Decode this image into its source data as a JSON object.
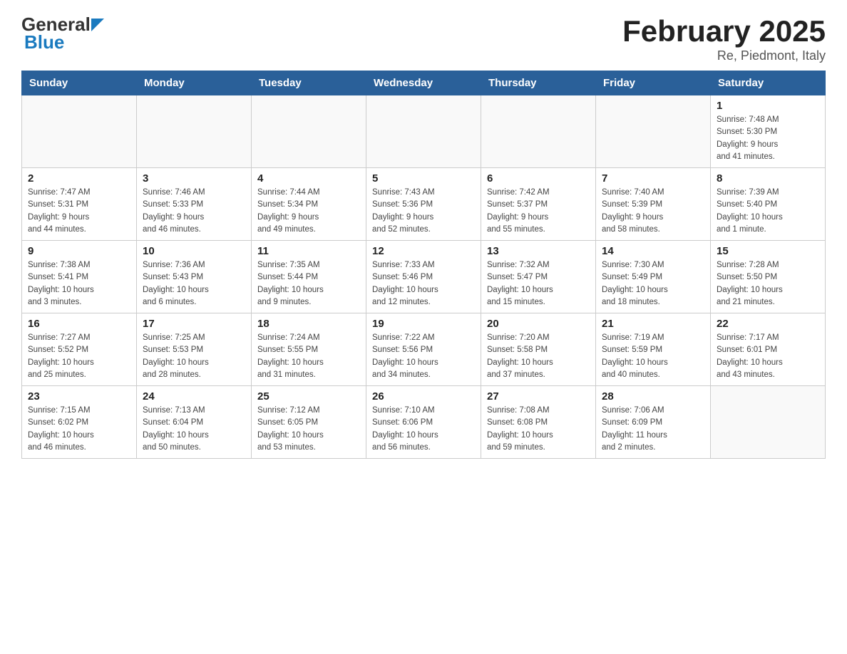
{
  "header": {
    "logo_general": "General",
    "logo_blue": "Blue",
    "title": "February 2025",
    "subtitle": "Re, Piedmont, Italy"
  },
  "weekdays": [
    "Sunday",
    "Monday",
    "Tuesday",
    "Wednesday",
    "Thursday",
    "Friday",
    "Saturday"
  ],
  "weeks": [
    [
      {
        "day": "",
        "info": ""
      },
      {
        "day": "",
        "info": ""
      },
      {
        "day": "",
        "info": ""
      },
      {
        "day": "",
        "info": ""
      },
      {
        "day": "",
        "info": ""
      },
      {
        "day": "",
        "info": ""
      },
      {
        "day": "1",
        "info": "Sunrise: 7:48 AM\nSunset: 5:30 PM\nDaylight: 9 hours\nand 41 minutes."
      }
    ],
    [
      {
        "day": "2",
        "info": "Sunrise: 7:47 AM\nSunset: 5:31 PM\nDaylight: 9 hours\nand 44 minutes."
      },
      {
        "day": "3",
        "info": "Sunrise: 7:46 AM\nSunset: 5:33 PM\nDaylight: 9 hours\nand 46 minutes."
      },
      {
        "day": "4",
        "info": "Sunrise: 7:44 AM\nSunset: 5:34 PM\nDaylight: 9 hours\nand 49 minutes."
      },
      {
        "day": "5",
        "info": "Sunrise: 7:43 AM\nSunset: 5:36 PM\nDaylight: 9 hours\nand 52 minutes."
      },
      {
        "day": "6",
        "info": "Sunrise: 7:42 AM\nSunset: 5:37 PM\nDaylight: 9 hours\nand 55 minutes."
      },
      {
        "day": "7",
        "info": "Sunrise: 7:40 AM\nSunset: 5:39 PM\nDaylight: 9 hours\nand 58 minutes."
      },
      {
        "day": "8",
        "info": "Sunrise: 7:39 AM\nSunset: 5:40 PM\nDaylight: 10 hours\nand 1 minute."
      }
    ],
    [
      {
        "day": "9",
        "info": "Sunrise: 7:38 AM\nSunset: 5:41 PM\nDaylight: 10 hours\nand 3 minutes."
      },
      {
        "day": "10",
        "info": "Sunrise: 7:36 AM\nSunset: 5:43 PM\nDaylight: 10 hours\nand 6 minutes."
      },
      {
        "day": "11",
        "info": "Sunrise: 7:35 AM\nSunset: 5:44 PM\nDaylight: 10 hours\nand 9 minutes."
      },
      {
        "day": "12",
        "info": "Sunrise: 7:33 AM\nSunset: 5:46 PM\nDaylight: 10 hours\nand 12 minutes."
      },
      {
        "day": "13",
        "info": "Sunrise: 7:32 AM\nSunset: 5:47 PM\nDaylight: 10 hours\nand 15 minutes."
      },
      {
        "day": "14",
        "info": "Sunrise: 7:30 AM\nSunset: 5:49 PM\nDaylight: 10 hours\nand 18 minutes."
      },
      {
        "day": "15",
        "info": "Sunrise: 7:28 AM\nSunset: 5:50 PM\nDaylight: 10 hours\nand 21 minutes."
      }
    ],
    [
      {
        "day": "16",
        "info": "Sunrise: 7:27 AM\nSunset: 5:52 PM\nDaylight: 10 hours\nand 25 minutes."
      },
      {
        "day": "17",
        "info": "Sunrise: 7:25 AM\nSunset: 5:53 PM\nDaylight: 10 hours\nand 28 minutes."
      },
      {
        "day": "18",
        "info": "Sunrise: 7:24 AM\nSunset: 5:55 PM\nDaylight: 10 hours\nand 31 minutes."
      },
      {
        "day": "19",
        "info": "Sunrise: 7:22 AM\nSunset: 5:56 PM\nDaylight: 10 hours\nand 34 minutes."
      },
      {
        "day": "20",
        "info": "Sunrise: 7:20 AM\nSunset: 5:58 PM\nDaylight: 10 hours\nand 37 minutes."
      },
      {
        "day": "21",
        "info": "Sunrise: 7:19 AM\nSunset: 5:59 PM\nDaylight: 10 hours\nand 40 minutes."
      },
      {
        "day": "22",
        "info": "Sunrise: 7:17 AM\nSunset: 6:01 PM\nDaylight: 10 hours\nand 43 minutes."
      }
    ],
    [
      {
        "day": "23",
        "info": "Sunrise: 7:15 AM\nSunset: 6:02 PM\nDaylight: 10 hours\nand 46 minutes."
      },
      {
        "day": "24",
        "info": "Sunrise: 7:13 AM\nSunset: 6:04 PM\nDaylight: 10 hours\nand 50 minutes."
      },
      {
        "day": "25",
        "info": "Sunrise: 7:12 AM\nSunset: 6:05 PM\nDaylight: 10 hours\nand 53 minutes."
      },
      {
        "day": "26",
        "info": "Sunrise: 7:10 AM\nSunset: 6:06 PM\nDaylight: 10 hours\nand 56 minutes."
      },
      {
        "day": "27",
        "info": "Sunrise: 7:08 AM\nSunset: 6:08 PM\nDaylight: 10 hours\nand 59 minutes."
      },
      {
        "day": "28",
        "info": "Sunrise: 7:06 AM\nSunset: 6:09 PM\nDaylight: 11 hours\nand 2 minutes."
      },
      {
        "day": "",
        "info": ""
      }
    ]
  ]
}
